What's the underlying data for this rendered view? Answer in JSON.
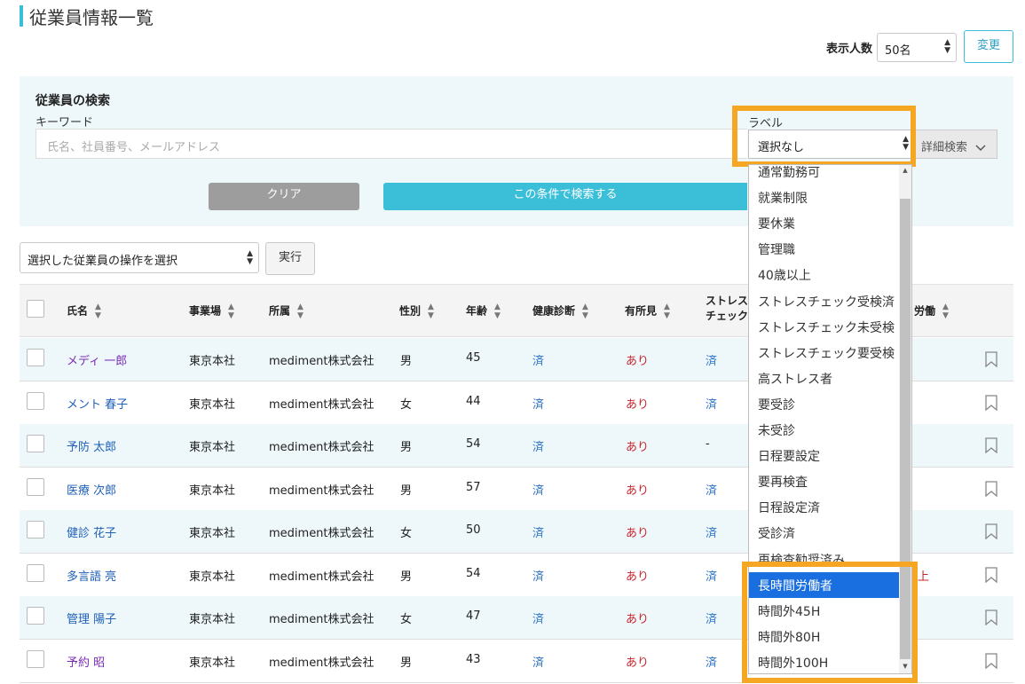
{
  "page": {
    "title": "従業員情報一覧"
  },
  "per_page": {
    "label": "表示人数",
    "value": "50名",
    "change_button": "変更"
  },
  "search": {
    "heading": "従業員の検索",
    "keyword_label": "キーワード",
    "keyword_placeholder": "氏名、社員番号、メールアドレス",
    "label_label": "ラベル",
    "label_value": "選択なし",
    "detail_button": "詳細検索",
    "clear_button": "クリア",
    "search_button": "この条件で検索する"
  },
  "bulk": {
    "select_value": "選択した従業員の操作を選択",
    "exec_button": "実行"
  },
  "table": {
    "headers": {
      "name": "氏名",
      "office": "事業場",
      "affiliation": "所属",
      "gender": "性別",
      "age": "年齢",
      "health_check": "健康診断",
      "finding": "有所見",
      "stress_1": "ストレス",
      "stress_2": "チェック",
      "overtime": "労働"
    },
    "rows": [
      {
        "name": "メディ 一郎",
        "office": "東京本社",
        "affiliation": "mediment株式会社",
        "gender": "男",
        "age": "45",
        "health": "済",
        "finding": "あり",
        "stress": "済",
        "name_style": "visited"
      },
      {
        "name": "メント 春子",
        "office": "東京本社",
        "affiliation": "mediment株式会社",
        "gender": "女",
        "age": "44",
        "health": "済",
        "finding": "あり",
        "stress": "済",
        "name_style": "link"
      },
      {
        "name": "予防 太郎",
        "office": "東京本社",
        "affiliation": "mediment株式会社",
        "gender": "男",
        "age": "54",
        "health": "済",
        "finding": "あり",
        "stress": "-",
        "name_style": "link"
      },
      {
        "name": "医療 次郎",
        "office": "東京本社",
        "affiliation": "mediment株式会社",
        "gender": "男",
        "age": "57",
        "health": "済",
        "finding": "あり",
        "stress": "済",
        "name_style": "link"
      },
      {
        "name": "健診 花子",
        "office": "東京本社",
        "affiliation": "mediment株式会社",
        "gender": "女",
        "age": "50",
        "health": "済",
        "finding": "あり",
        "stress": "済",
        "name_style": "link"
      },
      {
        "name": "多言語 亮",
        "office": "東京本社",
        "affiliation": "mediment株式会社",
        "gender": "男",
        "age": "54",
        "health": "済",
        "finding": "あり",
        "stress": "済",
        "name_style": "link",
        "overtime_fragment": "上"
      },
      {
        "name": "管理 陽子",
        "office": "東京本社",
        "affiliation": "mediment株式会社",
        "gender": "女",
        "age": "47",
        "health": "済",
        "finding": "あり",
        "stress": "済",
        "name_style": "link"
      },
      {
        "name": "予約 昭",
        "office": "東京本社",
        "affiliation": "mediment株式会社",
        "gender": "男",
        "age": "43",
        "health": "済",
        "finding": "あり",
        "stress": "済",
        "name_style": "visited"
      }
    ]
  },
  "label_dropdown": {
    "items": [
      "通常勤務可",
      "就業制限",
      "要休業",
      "管理職",
      "40歳以上",
      "ストレスチェック受検済",
      "ストレスチェック未受検",
      "ストレスチェック要受検",
      "高ストレス者",
      "要受診",
      "未受診",
      "日程要設定",
      "要再検査",
      "日程設定済",
      "受診済",
      "再検査勧奨済み",
      "長時間労働者",
      "時間外45H",
      "時間外80H",
      "時間外100H"
    ],
    "selected": "長時間労働者"
  },
  "colors": {
    "accent": "#3bbdd8",
    "highlight": "#f5a623",
    "link": "#2060b8",
    "alert": "#c8232c"
  }
}
